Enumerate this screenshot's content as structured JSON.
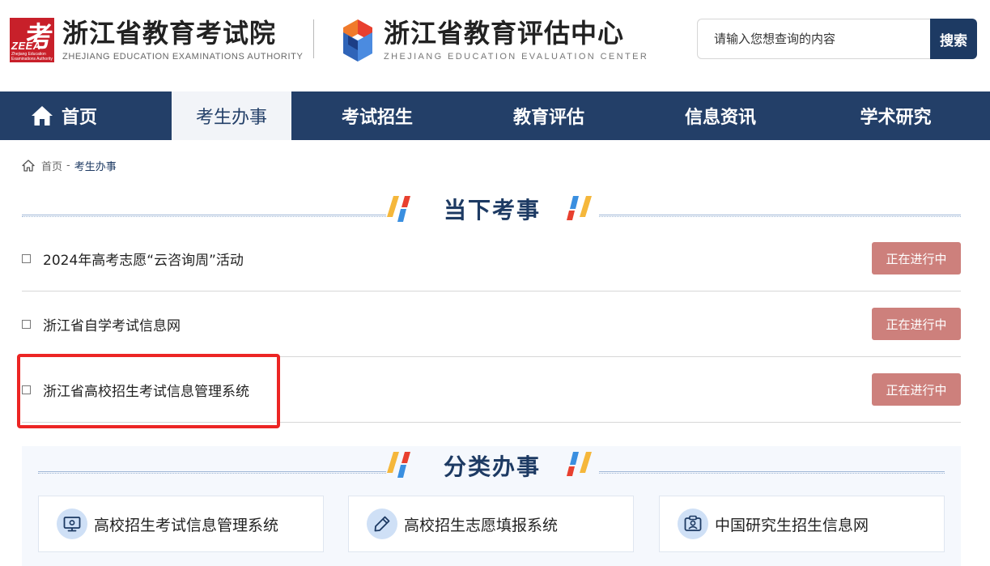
{
  "header": {
    "org1": {
      "name_cn": "浙江省教育考试院",
      "name_en": "ZHEJIANG EDUCATION EXAMINATIONS AUTHORITY",
      "logo_char": "考",
      "logo_abbr": "ZEEA",
      "logo_small": "Zhejiang Education Examinations Authority"
    },
    "org2": {
      "name_cn": "浙江省教育评估中心",
      "name_en": "ZHEJIANG EDUCATION EVALUATION CENTER"
    },
    "search": {
      "placeholder": "请输入您想查询的内容",
      "button_label": "搜索"
    }
  },
  "nav": {
    "items": [
      {
        "label": "首页",
        "icon": "home-icon",
        "active": false
      },
      {
        "label": "考生办事",
        "active": true
      },
      {
        "label": "考试招生",
        "active": false
      },
      {
        "label": "教育评估",
        "active": false
      },
      {
        "label": "信息资讯",
        "active": false
      },
      {
        "label": "学术研究",
        "active": false
      }
    ]
  },
  "breadcrumb": {
    "home": "首页",
    "separator": "-",
    "current": "考生办事"
  },
  "current_events": {
    "title": "当下考事",
    "items": [
      {
        "title": "2024年高考志愿“云咨询周”活动",
        "status": "正在进行中"
      },
      {
        "title": "浙江省自学考试信息网",
        "status": "正在进行中"
      },
      {
        "title": "浙江省高校招生考试信息管理系统",
        "status": "正在进行中",
        "highlighted": true
      }
    ]
  },
  "categories": {
    "title": "分类办事",
    "items": [
      {
        "label": "高校招生考试信息管理系统",
        "icon": "monitor-gear-icon"
      },
      {
        "label": "高校招生志愿填报系统",
        "icon": "pencil-icon"
      },
      {
        "label": "中国研究生招生信息网",
        "icon": "person-card-icon"
      }
    ]
  },
  "colors": {
    "nav_bg": "#233f68",
    "accent_navy": "#1d3a63",
    "badge_bg": "#cd807c",
    "highlight_border": "#ec2524",
    "logo_red": "#c8202a"
  }
}
